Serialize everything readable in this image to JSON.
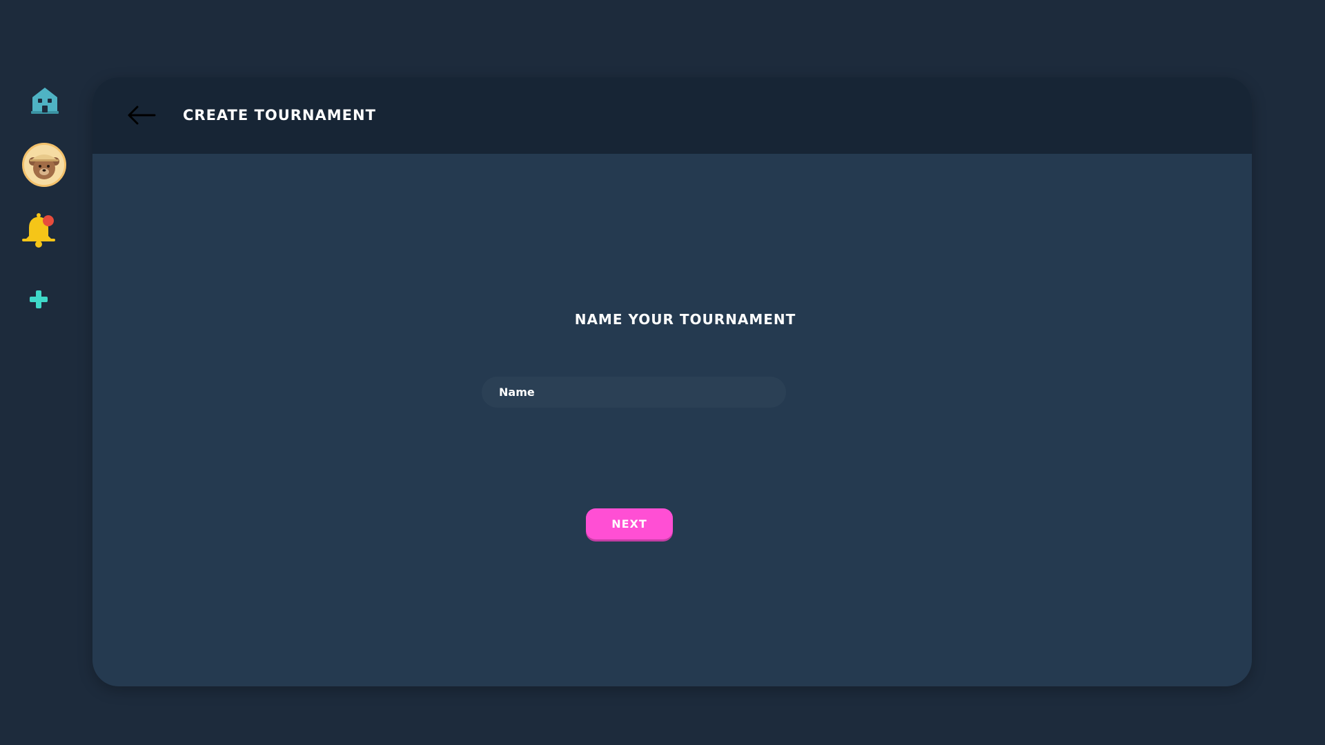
{
  "sidebar": {
    "items": [
      {
        "icon": "home-icon"
      },
      {
        "icon": "avatar-bear"
      },
      {
        "icon": "bell-icon",
        "has_notification": true
      },
      {
        "icon": "plus-icon"
      }
    ]
  },
  "header": {
    "back_icon": "arrow-left-icon",
    "title": "CREATE TOURNAMENT"
  },
  "form": {
    "title": "NAME YOUR TOURNAMENT",
    "name_input": {
      "placeholder": "Name",
      "value": ""
    },
    "next_label": "NEXT"
  },
  "colors": {
    "background": "#1d2b3c",
    "panel": "#253a50",
    "header": "#172535",
    "accent_button": "#ff4fd4",
    "home_icon": "#4fb3c4",
    "plus_icon": "#3fd9c8",
    "bell": "#f5c518",
    "notification_dot": "#e74c3c"
  }
}
